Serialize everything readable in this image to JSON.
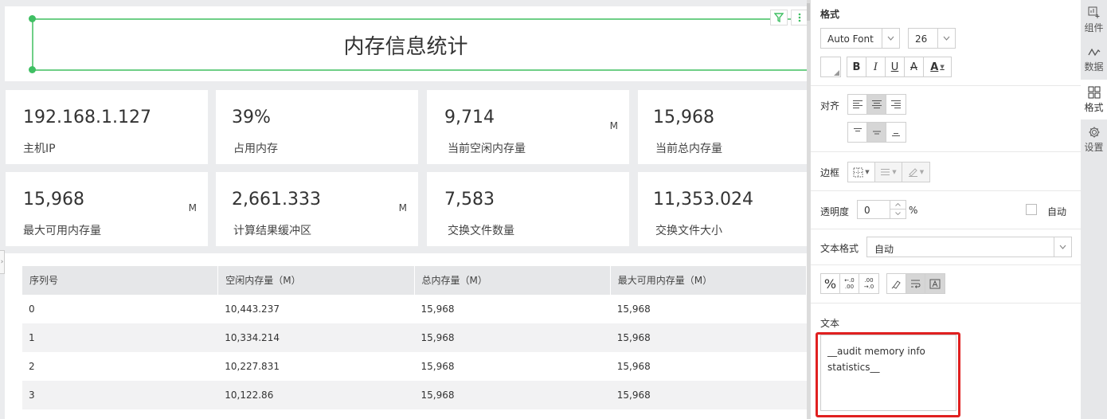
{
  "dashboard": {
    "title": "内存信息统计",
    "kpis_row1": [
      {
        "value": "192.168.1.127",
        "label": "主机IP",
        "unit": ""
      },
      {
        "value": "39%",
        "label": "占用内存",
        "unit": ""
      },
      {
        "value": "9,714",
        "label": "当前空闲内存量",
        "unit": "M"
      },
      {
        "value": "15,968",
        "label": "当前总内存量",
        "unit": ""
      }
    ],
    "kpis_row2": [
      {
        "value": "15,968",
        "label": "最大可用内存量",
        "unit": "M"
      },
      {
        "value": "2,661.333",
        "label": "计算结果缓冲区",
        "unit": "M"
      },
      {
        "value": "7,583",
        "label": "交换文件数量",
        "unit": ""
      },
      {
        "value": "11,353.024",
        "label": "交换文件大小",
        "unit": ""
      }
    ],
    "table": {
      "columns": [
        "序列号",
        "空闲内存量（M）",
        "总内存量（M）",
        "最大可用内存量（M）"
      ],
      "rows": [
        [
          "0",
          "10,443.237",
          "15,968",
          "15,968"
        ],
        [
          "1",
          "10,334.214",
          "15,968",
          "15,968"
        ],
        [
          "2",
          "10,227.831",
          "15,968",
          "15,968"
        ],
        [
          "3",
          "10,122.86",
          "15,968",
          "15,968"
        ]
      ]
    }
  },
  "panel": {
    "heading": "格式",
    "font_select": "Auto Font",
    "size_select": "26",
    "style_buttons": [
      "B",
      "I",
      "U",
      "A",
      "A"
    ],
    "align_label": "对齐",
    "border_label": "边框",
    "opacity_label": "透明度",
    "opacity_value": "0",
    "opacity_unit": "%",
    "auto_label": "自动",
    "text_format_label": "文本格式",
    "text_format_value": "自动",
    "number_buttons": [
      "%",
      "←.0 .00",
      ".00 →.0"
    ],
    "text_label": "文本",
    "text_value": "__audit memory info statistics__"
  },
  "sidebar": {
    "items": [
      {
        "label": "组件",
        "icon": "component-icon"
      },
      {
        "label": "数据",
        "icon": "data-icon"
      },
      {
        "label": "格式",
        "icon": "format-icon"
      },
      {
        "label": "设置",
        "icon": "settings-icon"
      }
    ]
  },
  "colors": {
    "accent_green": "#3fbf63",
    "highlight_red": "#e02020"
  }
}
